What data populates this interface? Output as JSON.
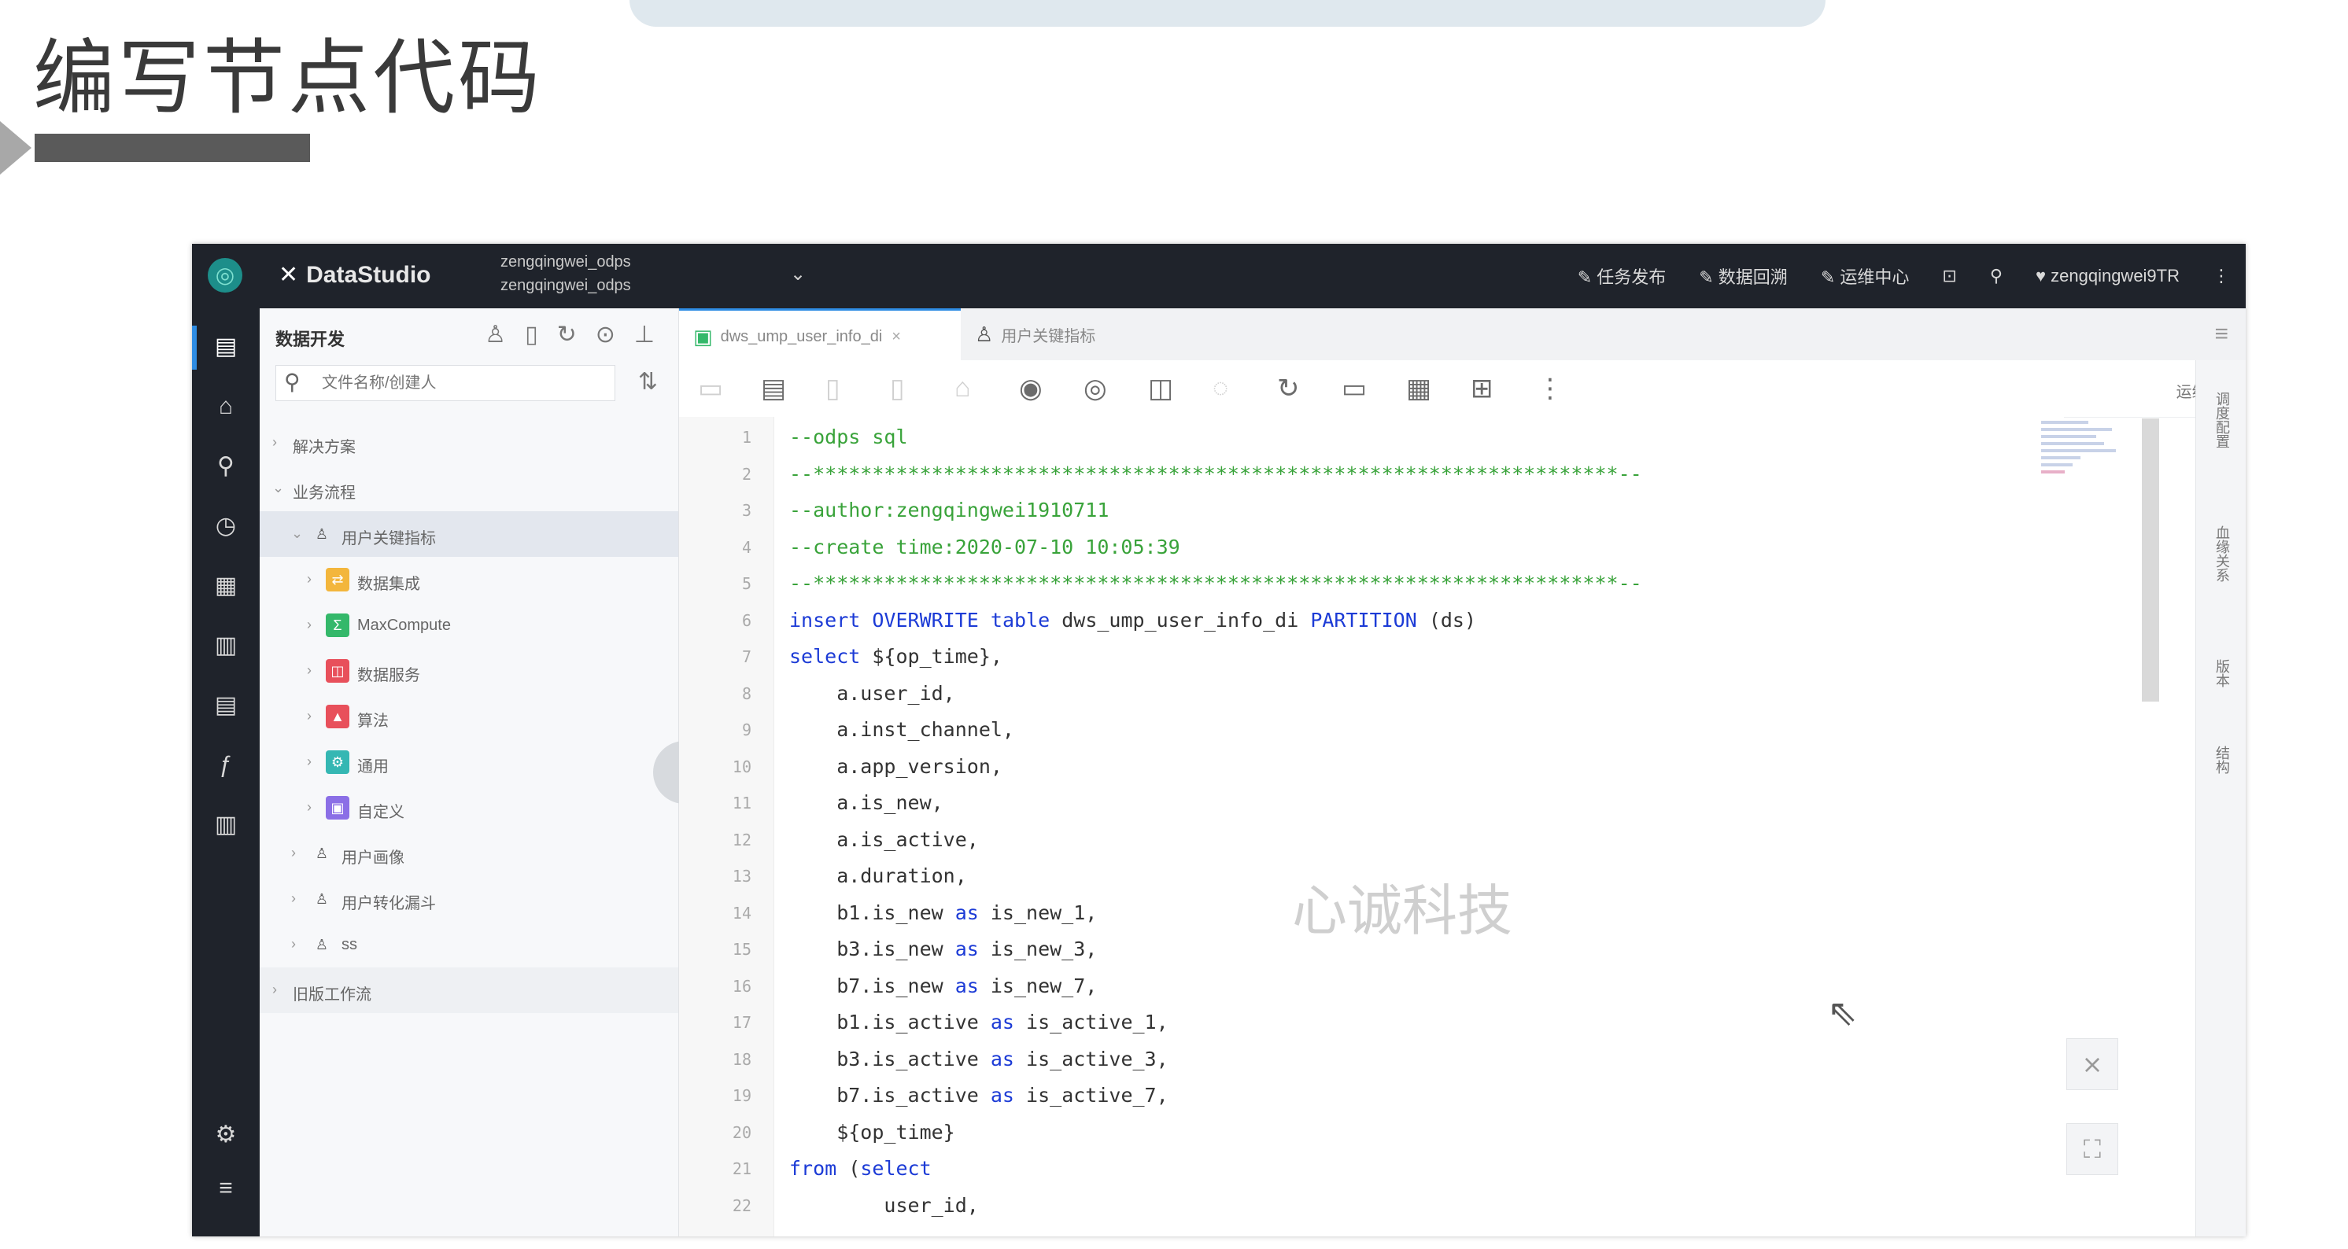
{
  "slide": {
    "title": "编写节点代码"
  },
  "app": {
    "brand": "DataStudio",
    "project": [
      "zengqingwei_odps",
      "zengqingwei_odps"
    ],
    "top_links": [
      "任务发布",
      "数据回溯",
      "运维中心"
    ],
    "user": "zengqingwei9TR"
  },
  "tree": {
    "title": "数据开发",
    "search_placeholder": "文件名称/创建人",
    "items": [
      {
        "label": "解决方案",
        "level": 0
      },
      {
        "label": "业务流程",
        "level": 0
      },
      {
        "label": "用户关键指标",
        "level": 1
      },
      {
        "label": "数据集成",
        "level": 2,
        "color": "#f3b63c",
        "glyph": "⇄"
      },
      {
        "label": "MaxCompute",
        "level": 2,
        "color": "#34b86a",
        "glyph": "Σ"
      },
      {
        "label": "数据服务",
        "level": 2,
        "color": "#e8505b",
        "glyph": "◫"
      },
      {
        "label": "算法",
        "level": 2,
        "color": "#e8505b",
        "glyph": "▲"
      },
      {
        "label": "通用",
        "level": 2,
        "color": "#35b7b3",
        "glyph": "⚙"
      },
      {
        "label": "自定义",
        "level": 2,
        "color": "#8b6fe6",
        "glyph": "▣"
      },
      {
        "label": "用户画像",
        "level": 1
      },
      {
        "label": "用户转化漏斗",
        "level": 1
      },
      {
        "label": "ss",
        "level": 1
      },
      {
        "label": "旧版工作流",
        "level": 0
      }
    ]
  },
  "tabs": [
    {
      "label": "dws_ump_user_info_di"
    },
    {
      "label": "用户关键指标"
    }
  ],
  "toolbar": {
    "right_label": "运维"
  },
  "code": [
    "--odps sql",
    "--********************************************************************--",
    "--author:zengqingwei1910711",
    "--create time:2020-07-10 10:05:39",
    "--********************************************************************--",
    "insert OVERWRITE table dws_ump_user_info_di PARTITION (ds)",
    "select ${op_time},",
    "    a.user_id,",
    "    a.inst_channel,",
    "    a.app_version,",
    "    a.is_new,",
    "    a.is_active,",
    "    a.duration,",
    "    b1.is_new as is_new_1,",
    "    b3.is_new as is_new_3,",
    "    b7.is_new as is_new_7,",
    "    b1.is_active as is_active_1,",
    "    b3.is_active as is_active_3,",
    "    b7.is_active as is_active_7,",
    "    ${op_time}",
    "from (select",
    "        user_id,"
  ],
  "watermark": "心诚科技",
  "right_rail": [
    "调度配置",
    "血缘关系",
    "版本",
    "结构"
  ]
}
